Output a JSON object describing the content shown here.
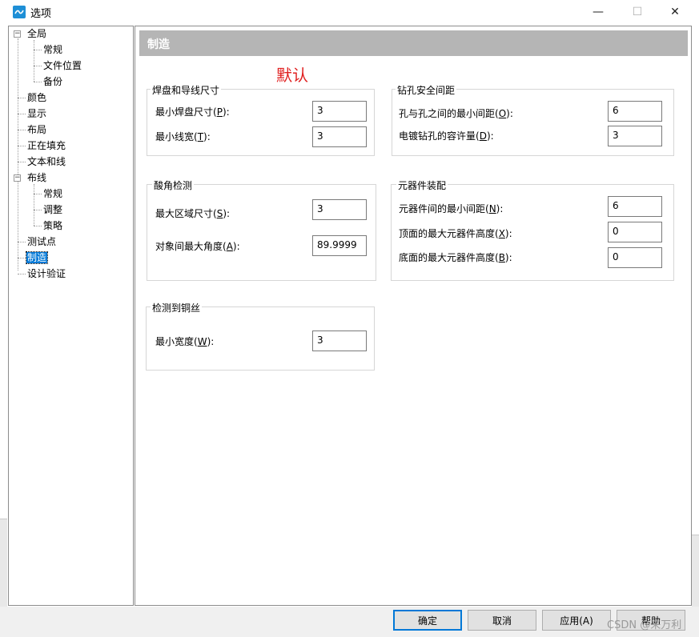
{
  "window": {
    "title": "选项",
    "minimize": "—",
    "maximize": "☐",
    "close": "✕"
  },
  "tree": {
    "items": [
      {
        "label": "全局",
        "expander": "−"
      },
      {
        "label": "常规"
      },
      {
        "label": "文件位置"
      },
      {
        "label": "备份"
      },
      {
        "label": "颜色"
      },
      {
        "label": "显示"
      },
      {
        "label": "布局"
      },
      {
        "label": "正在填充"
      },
      {
        "label": "文本和线"
      },
      {
        "label": "布线",
        "expander": "−"
      },
      {
        "label": "常规"
      },
      {
        "label": "调整"
      },
      {
        "label": "策略"
      },
      {
        "label": "测试点"
      },
      {
        "label": "制造",
        "selected": true
      },
      {
        "label": "设计验证"
      }
    ]
  },
  "main": {
    "section_title": "制造",
    "annotation": "默认",
    "groups": {
      "pad_trace": {
        "title": "焊盘和导线尺寸",
        "min_pad_label": "最小焊盘尺寸(",
        "min_pad_key": "P",
        "min_pad_value": "3",
        "min_width_label": "最小线宽(",
        "min_width_key": "T",
        "min_width_value": "3"
      },
      "drill": {
        "title": "钻孔安全间距",
        "hole_to_hole_label": "孔与孔之间的最小间距(",
        "hole_to_hole_key": "O",
        "hole_to_hole_value": "6",
        "plated_tol_label": "电镀钻孔的容许量(",
        "plated_tol_key": "D",
        "plated_tol_value": "3"
      },
      "acid": {
        "title": "酸角检测",
        "max_area_label": "最大区域尺寸(",
        "max_area_key": "S",
        "max_area_value": "3",
        "max_angle_label": "对象间最大角度(",
        "max_angle_key": "A",
        "max_angle_value": "89.9999"
      },
      "assembly": {
        "title": "元器件装配",
        "min_spacing_label": "元器件间的最小间距(",
        "min_spacing_key": "N",
        "min_spacing_value": "6",
        "top_height_label": "顶面的最大元器件高度(",
        "top_height_key": "X",
        "top_height_value": "0",
        "bottom_height_label": "底面的最大元器件高度(",
        "bottom_height_key": "B",
        "bottom_height_value": "0"
      },
      "sliver": {
        "title": "检测到铜丝",
        "min_width_label": "最小宽度(",
        "min_width_key": "W",
        "min_width_value": "3"
      }
    }
  },
  "buttons": {
    "ok": "确定",
    "cancel": "取消",
    "apply": "应用(A)",
    "help": "帮助"
  },
  "watermark": "CSDN @来万利"
}
